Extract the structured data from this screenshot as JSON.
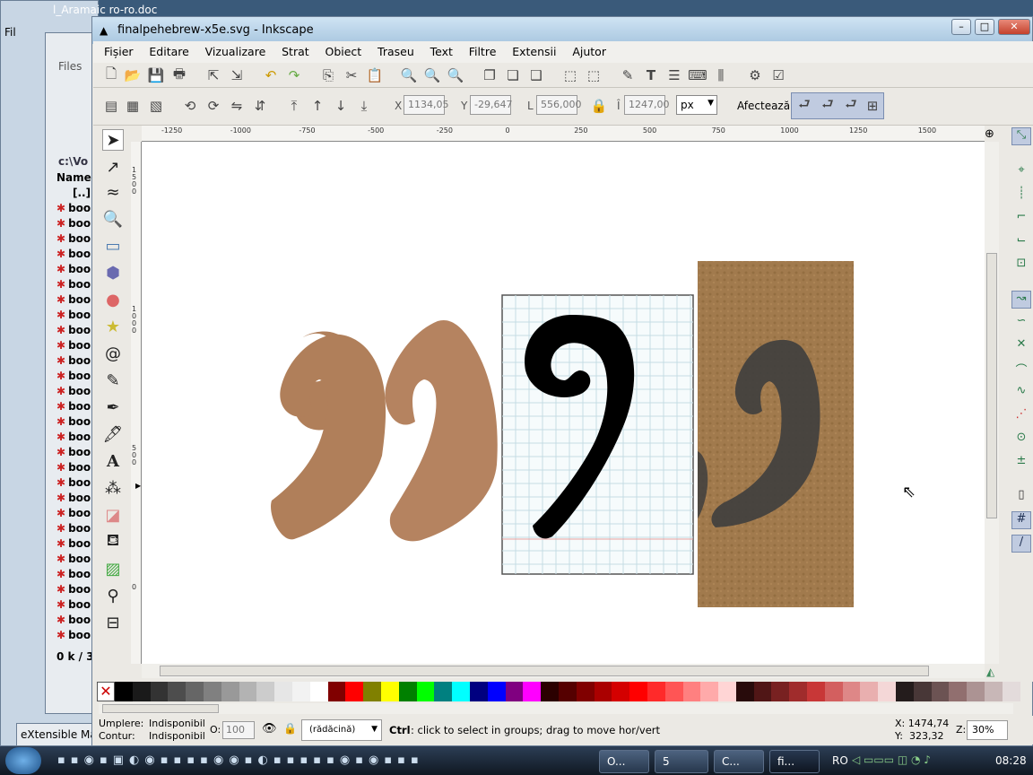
{
  "background_windows": {
    "top_title": "l_Aramaic ro-ro.doc",
    "file_menu_short": "Fil",
    "files_tab": "Files",
    "panel_header": "Name",
    "path": "c:\\Vo",
    "parent": "[..]",
    "file_items": [
      "boo",
      "boo",
      "boo",
      "boo",
      "boo",
      "boo",
      "boo",
      "boo",
      "boo",
      "boo",
      "boo",
      "boo",
      "boo",
      "boo",
      "boo",
      "boo",
      "boo",
      "boo",
      "boo",
      "boo",
      "boo",
      "boo",
      "boo",
      "boo",
      "boo",
      "boo",
      "boo",
      "boo",
      "boo",
      "boo"
    ],
    "status": "0 k / 3",
    "extensible": "eXtensible Mar"
  },
  "window": {
    "title": "finalpehebrew-x5e.svg - Inkscape"
  },
  "menu": [
    "Fișier",
    "Editare",
    "Vizualizare",
    "Strat",
    "Obiect",
    "Traseu",
    "Text",
    "Filtre",
    "Extensii",
    "Ajutor"
  ],
  "toolbar2": {
    "x_label": "X",
    "x_value": "1134,05",
    "y_label": "Y",
    "y_value": "-29,647",
    "w_label": "L",
    "w_value": "556,000",
    "h_label": "Î",
    "h_value": "1247,00",
    "unit": "px",
    "affect_label": "Afectează:"
  },
  "ruler_labels": [
    "-1250",
    "-1000",
    "-750",
    "-500",
    "-250",
    "0",
    "250",
    "500",
    "750",
    "1000",
    "1250",
    "1500"
  ],
  "vruler_labels": [
    "1500",
    "1000",
    "500",
    "0"
  ],
  "status": {
    "fill_label": "Umplere:",
    "fill_value": "Indisponibil",
    "stroke_label": "Contur:",
    "stroke_value": "Indisponibil",
    "opacity_label": "O:",
    "opacity_value": "100",
    "layer": "(rădăcină)",
    "hint_key": "Ctrl",
    "hint": ": click to select in groups; drag to move hor/vert",
    "cx": "X: 1474,74",
    "cy": "Y:  323,32",
    "zoom_label": "Z:",
    "zoom": "30%"
  },
  "taskbar": {
    "tasks": [
      "O...",
      "5",
      "C...",
      "fi..."
    ],
    "lang": "RO",
    "clock": "08:28"
  },
  "colors": {
    "glyph_tan": "#b07f5a",
    "glyph_tan2": "#b58360",
    "parchment": "#9c7548"
  },
  "palette": [
    "#000000",
    "#1a1a1a",
    "#333333",
    "#4d4d4d",
    "#666666",
    "#808080",
    "#999999",
    "#b3b3b3",
    "#cccccc",
    "#e6e6e6",
    "#f2f2f2",
    "#ffffff",
    "#800000",
    "#ff0000",
    "#808000",
    "#ffff00",
    "#008000",
    "#00ff00",
    "#008080",
    "#00ffff",
    "#000080",
    "#0000ff",
    "#800080",
    "#ff00ff",
    "#2b0000",
    "#550000",
    "#800000",
    "#aa0000",
    "#d40000",
    "#ff0000",
    "#ff2a2a",
    "#ff5555",
    "#ff8080",
    "#ffaaaa",
    "#ffd5d5",
    "#280b0b",
    "#501616",
    "#782121",
    "#a02c2c",
    "#c83737",
    "#d35f5f",
    "#de8787",
    "#e9afaf",
    "#f4d7d7",
    "#241c1c",
    "#483737",
    "#6c5353",
    "#916f6f",
    "#ac9393",
    "#c8b7b7",
    "#e3dbdb"
  ]
}
